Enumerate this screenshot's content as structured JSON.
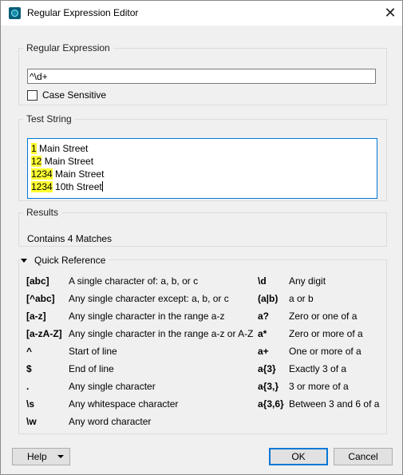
{
  "window": {
    "title": "Regular Expression Editor",
    "close_glyph": "✕"
  },
  "regex_group": {
    "legend": "Regular Expression",
    "value": "^\\d+",
    "case_sensitive_label": "Case Sensitive",
    "case_sensitive_checked": false
  },
  "test_group": {
    "legend": "Test String",
    "lines": [
      {
        "match": "1",
        "rest": " Main Street"
      },
      {
        "match": "12",
        "rest": " Main Street"
      },
      {
        "match": "1234",
        "rest": " Main Street"
      },
      {
        "match": "1234",
        "rest": " 10th Street"
      }
    ],
    "highlight_color": "#ffff33"
  },
  "results_group": {
    "legend": "Results",
    "text": "Contains 4 Matches"
  },
  "quick_reference": {
    "header": "Quick Reference",
    "left": [
      {
        "sym": "[abc]",
        "desc": "A single character of: a, b, or c"
      },
      {
        "sym": "[^abc]",
        "desc": "Any single character except: a, b, or c"
      },
      {
        "sym": "[a-z]",
        "desc": "Any single character in the range a-z"
      },
      {
        "sym": "[a-zA-Z]",
        "desc": "Any single character in the range a-z or A-Z"
      },
      {
        "sym": "^",
        "desc": "Start of line"
      },
      {
        "sym": "$",
        "desc": "End of line"
      },
      {
        "sym": ".",
        "desc": "Any single character"
      },
      {
        "sym": "\\s",
        "desc": "Any whitespace character"
      },
      {
        "sym": "\\w",
        "desc": "Any word character"
      }
    ],
    "right": [
      {
        "sym": "\\d",
        "desc": "Any digit"
      },
      {
        "sym": "(a|b)",
        "desc": "a or b"
      },
      {
        "sym": "a?",
        "desc": "Zero or one of a"
      },
      {
        "sym": "a*",
        "desc": "Zero or more of a"
      },
      {
        "sym": "a+",
        "desc": "One or more of a"
      },
      {
        "sym": "a{3}",
        "desc": "Exactly 3 of a"
      },
      {
        "sym": "a{3,}",
        "desc": "3 or more of a"
      },
      {
        "sym": "a{3,6}",
        "desc": "Between 3 and 6 of a"
      }
    ]
  },
  "buttons": {
    "help": "Help",
    "ok": "OK",
    "cancel": "Cancel"
  }
}
